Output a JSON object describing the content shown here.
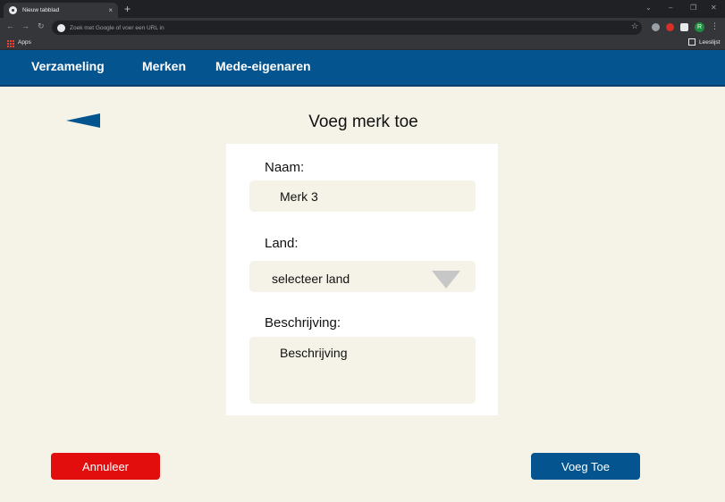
{
  "browser": {
    "tab_title": "Nieuw tabblad",
    "tab_close": "×",
    "new_tab": "+",
    "omnibox_placeholder": "Zoek met Google of voer een URL in",
    "bookmark_apps": "Apps",
    "reading_list": "Leeslijst",
    "avatar_letter": "R"
  },
  "nav": {
    "items": [
      "Verzameling",
      "Merken",
      "Mede-eigenaren"
    ]
  },
  "page": {
    "title": "Voeg merk toe"
  },
  "form": {
    "name_label": "Naam:",
    "name_value": "Merk 3",
    "country_label": "Land:",
    "country_value": "selecteer land",
    "description_label": "Beschrijving:",
    "description_value": "Beschrijving"
  },
  "actions": {
    "cancel": "Annuleer",
    "submit": "Voeg Toe"
  },
  "colors": {
    "primary": "#04548f",
    "danger": "#e20d0d",
    "background": "#f5f2e7"
  }
}
